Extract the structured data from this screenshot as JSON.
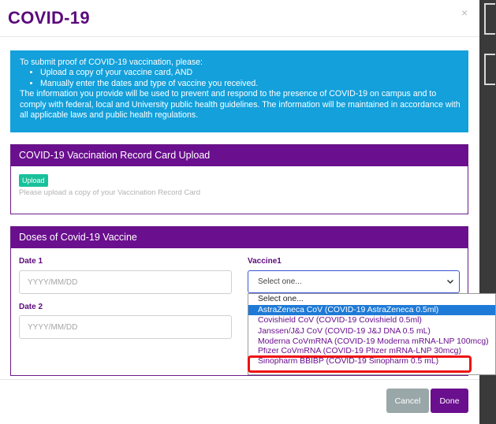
{
  "modal": {
    "title": "COVID-19",
    "close_glyph": "×"
  },
  "info": {
    "intro": "To submit proof of COVID-19 vaccination, please:",
    "steps": [
      "Upload a copy of your vaccine card, AND",
      "Manually enter the dates and type of vaccine you received."
    ],
    "body": "The information you provide will be used to prevent and respond to the presence of COVID-19 on campus and to comply with federal, local and University public health guidelines. The information will be maintained in accordance with all applicable laws and public health regulations."
  },
  "upload_panel": {
    "title": "COVID-19 Vaccination Record Card Upload",
    "button_label": "Upload",
    "hint": "Please upload a copy of your Vaccination Record Card"
  },
  "doses_panel": {
    "title": "Doses of Covid-19 Vaccine",
    "date1_label": "Date 1",
    "date2_label": "Date 2",
    "date_placeholder": "YYYY/MM/DD",
    "vaccine_label": "Vaccine1",
    "select_value": "Select one...",
    "options": [
      "Select one...",
      "AstraZeneca CoV (COVID-19 AstraZeneca 0.5ml)",
      "Covishield CoV (COVID-19 Covishield 0.5ml)",
      "Janssen/J&J CoV (COVID-19 J&J DNA 0.5 mL)",
      "Moderna CoVmRNA (COVID-19 Moderna mRNA-LNP 100mcg)",
      "Pfizer CoVmRNA (COVID-19 Pfizer mRNA-LNP 30mcg)",
      "Sinopharm BBIBP (COVID-19 Sinopharm 0.5 mL)"
    ]
  },
  "footer": {
    "cancel_label": "Cancel",
    "done_label": "Done"
  },
  "icons": {
    "chevron": "chevron-down-icon",
    "close": "close-icon"
  },
  "colors": {
    "brand_purple": "#6a0f8e",
    "title_purple": "#5b0a7a",
    "info_blue": "#13a0db",
    "upload_green": "#19c19b",
    "highlight_red": "#ee1111",
    "option_active": "#1e7ad6",
    "cancel_gray": "#9aa7a9"
  }
}
